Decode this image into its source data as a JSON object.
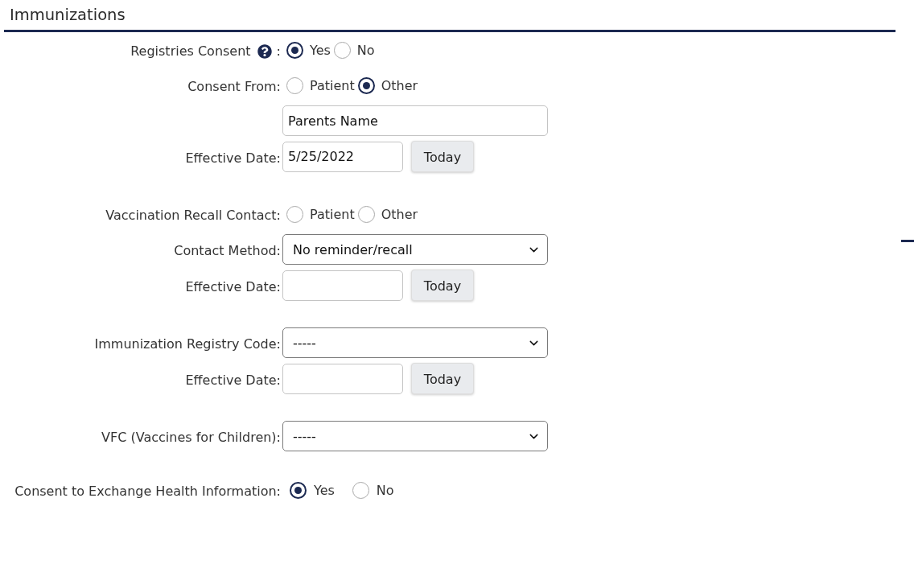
{
  "section": {
    "title": "Immunizations"
  },
  "groups": [
    {
      "rows": [
        {
          "kind": "radio",
          "label": "Registries Consent",
          "help": true,
          "label_end": ":",
          "options": [
            {
              "label": "Yes",
              "selected": true
            },
            {
              "label": "No",
              "selected": false
            }
          ]
        },
        {
          "kind": "radio",
          "label": "Consent From:",
          "options": [
            {
              "label": "Patient",
              "selected": false
            },
            {
              "label": "Other",
              "selected": true
            }
          ]
        },
        {
          "kind": "text",
          "value": "Parents Name"
        },
        {
          "kind": "date",
          "label": "Effective Date:",
          "value": "5/25/2022",
          "button": "Today"
        }
      ]
    },
    {
      "rows": [
        {
          "kind": "radio",
          "label": "Vaccination Recall Contact:",
          "options": [
            {
              "label": "Patient",
              "selected": false
            },
            {
              "label": "Other",
              "selected": false
            }
          ]
        },
        {
          "kind": "select",
          "label": "Contact Method:",
          "value": "No reminder/recall"
        },
        {
          "kind": "date",
          "label": "Effective Date:",
          "button": "Today"
        }
      ]
    },
    {
      "rows": [
        {
          "kind": "select",
          "label": "Immunization Registry Code:",
          "value": "-----"
        },
        {
          "kind": "date",
          "label": "Effective Date:",
          "button": "Today"
        }
      ]
    },
    {
      "rows": [
        {
          "kind": "select",
          "label": "VFC (Vaccines for Children):",
          "value": "-----"
        }
      ]
    },
    {
      "rows": [
        {
          "kind": "choice",
          "label": "Consent to Exchange Health Information:",
          "options": [
            {
              "label": "Yes",
              "selected": true
            },
            {
              "label": "No",
              "selected": false
            }
          ]
        }
      ]
    }
  ]
}
